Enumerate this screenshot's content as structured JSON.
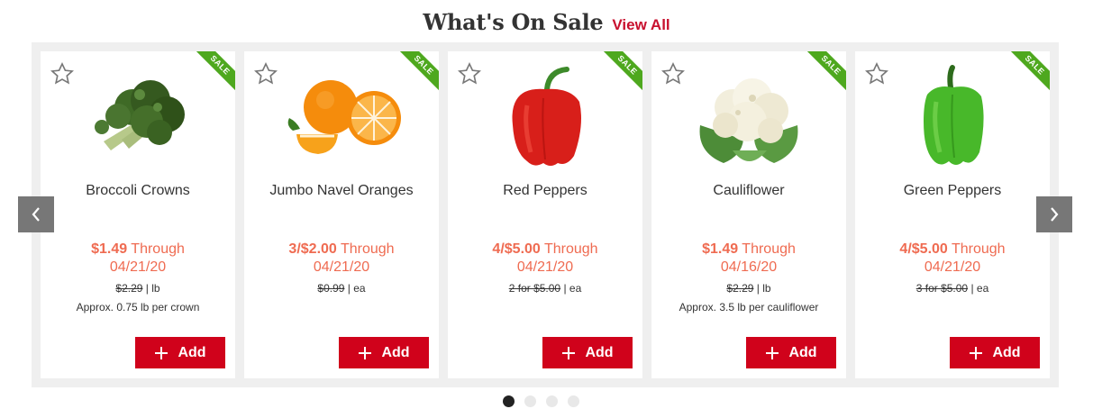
{
  "header": {
    "title": "What's On Sale",
    "view_all": "View All"
  },
  "ribbon_label": "SALE",
  "add_label": "Add",
  "colors": {
    "brand_red": "#d0021b",
    "sale_price": "#ef6b51",
    "ribbon_green": "#4ea81e"
  },
  "products": [
    {
      "name": "Broccoli Crowns",
      "sale_price": "$1.49",
      "through": "Through",
      "date": "04/21/20",
      "regular_price": "$2.29",
      "unit": "| lb",
      "note": "Approx. 0.75 lb per crown",
      "image": "broccoli-image"
    },
    {
      "name": "Jumbo Navel Oranges",
      "sale_price": "3/$2.00",
      "through": "Through",
      "date": "04/21/20",
      "regular_price": "$0.99",
      "unit": "| ea",
      "note": "",
      "image": "oranges-image"
    },
    {
      "name": "Red Peppers",
      "sale_price": "4/$5.00",
      "through": "Through",
      "date": "04/21/20",
      "regular_price": "2 for $5.00",
      "unit": "| ea",
      "note": "",
      "image": "red-pepper-image"
    },
    {
      "name": "Cauliflower",
      "sale_price": "$1.49",
      "through": "Through",
      "date": "04/16/20",
      "regular_price": "$2.29",
      "unit": "| lb",
      "note": "Approx. 3.5 lb per cauliflower",
      "image": "cauliflower-image"
    },
    {
      "name": "Green Peppers",
      "sale_price": "4/$5.00",
      "through": "Through",
      "date": "04/21/20",
      "regular_price": "3 for $5.00",
      "unit": "| ea",
      "note": "",
      "image": "green-pepper-image"
    }
  ],
  "pagination": {
    "pages": 4,
    "active": 1
  }
}
